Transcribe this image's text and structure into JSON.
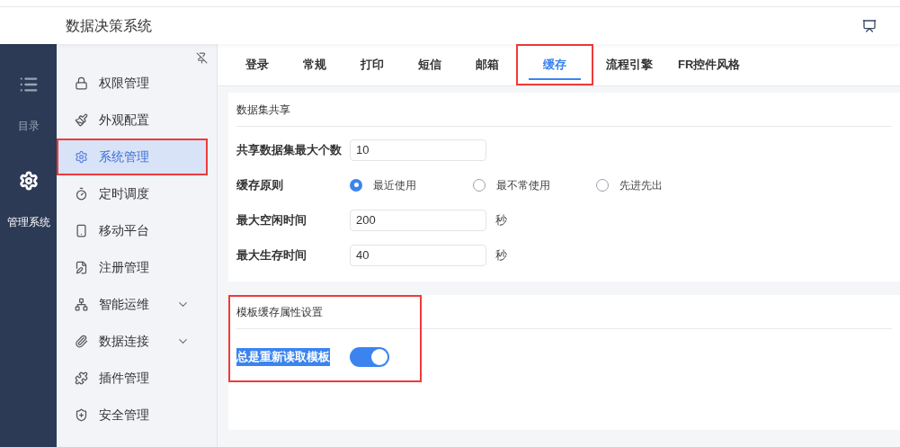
{
  "header": {
    "title": "数据决策系统"
  },
  "rail": [
    {
      "kind": "list",
      "label": "目录",
      "selected": false
    },
    {
      "kind": "gear",
      "label": "管理系统",
      "selected": true
    }
  ],
  "sidebar": {
    "items": [
      {
        "kind": "lock",
        "label": "权限管理",
        "selected": false,
        "annotated": false
      },
      {
        "kind": "roller",
        "label": "外观配置",
        "selected": false,
        "annotated": false
      },
      {
        "kind": "gear",
        "label": "系统管理",
        "selected": true,
        "annotated": true
      },
      {
        "kind": "timer",
        "label": "定时调度",
        "selected": false,
        "annotated": false
      },
      {
        "kind": "phone",
        "label": "移动平台",
        "selected": false,
        "annotated": false
      },
      {
        "kind": "register",
        "label": "注册管理",
        "selected": false,
        "annotated": false
      },
      {
        "kind": "network",
        "label": "智能运维",
        "selected": false,
        "annotated": false,
        "expanded": false
      },
      {
        "kind": "clip",
        "label": "数据连接",
        "selected": false,
        "annotated": false,
        "expanded": false
      },
      {
        "kind": "puzzle",
        "label": "插件管理",
        "selected": false,
        "annotated": false
      },
      {
        "kind": "shield",
        "label": "安全管理",
        "selected": false,
        "annotated": false
      }
    ]
  },
  "tabs": [
    {
      "label": "登录",
      "selected": false,
      "annotated": false
    },
    {
      "label": "常规",
      "selected": false,
      "annotated": false
    },
    {
      "label": "打印",
      "selected": false,
      "annotated": false
    },
    {
      "label": "短信",
      "selected": false,
      "annotated": false
    },
    {
      "label": "邮箱",
      "selected": false,
      "annotated": false
    },
    {
      "label": "缓存",
      "selected": true,
      "annotated": true
    },
    {
      "label": "流程引擎",
      "selected": false,
      "annotated": false
    },
    {
      "label": "FR控件风格",
      "selected": false,
      "annotated": false
    }
  ],
  "sections": [
    {
      "title": "数据集共享",
      "annotated": false,
      "rows": [
        {
          "kind": "input",
          "label": "共享数据集最大个数",
          "value": "10"
        },
        {
          "kind": "radio",
          "label": "缓存原则",
          "options": [
            {
              "label": "最近使用",
              "selected": true
            },
            {
              "label": "最不常使用",
              "selected": false
            },
            {
              "label": "先进先出",
              "selected": false
            }
          ]
        },
        {
          "kind": "input",
          "label": "最大空闲时间",
          "value": "200",
          "unit": "秒"
        },
        {
          "kind": "input",
          "label": "最大生存时间",
          "value": "40",
          "unit": "秒"
        }
      ]
    },
    {
      "title": "模板缓存属性设置",
      "annotated": true,
      "rows": [
        {
          "kind": "switch",
          "label": "总是重新读取模板",
          "on": true,
          "label_selected": true
        }
      ]
    }
  ]
}
